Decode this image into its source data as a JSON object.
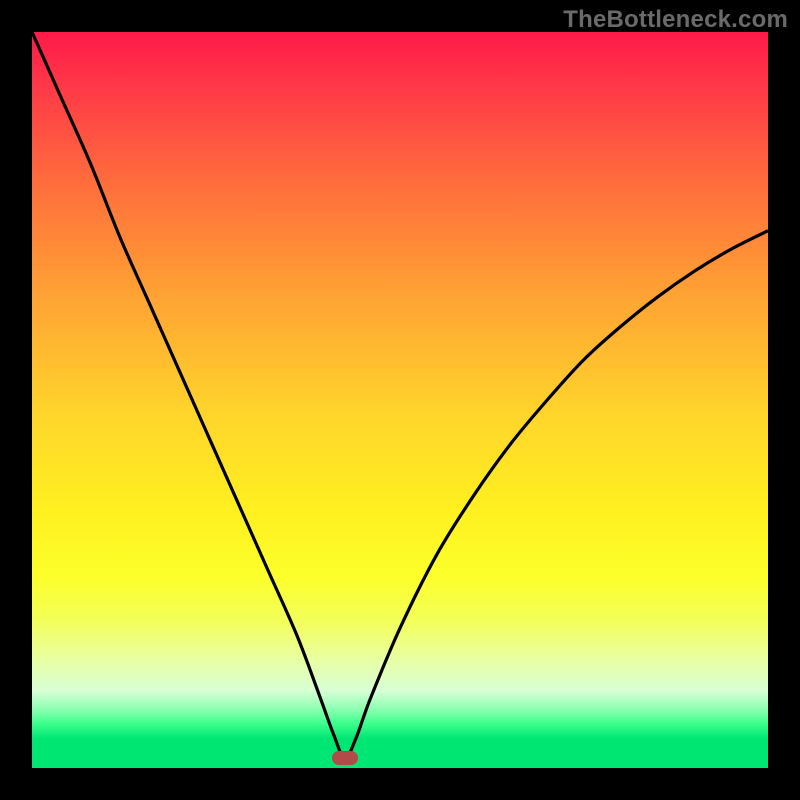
{
  "watermark": "TheBottleneck.com",
  "colors": {
    "frame": "#000000",
    "curve": "#000000",
    "marker": "#b24a4a",
    "gradient_top": "#ff1a49",
    "gradient_bottom": "#00e673"
  },
  "chart_data": {
    "type": "line",
    "title": "",
    "xlabel": "",
    "ylabel": "",
    "xlim": [
      0,
      100
    ],
    "ylim": [
      0,
      100
    ],
    "annotations": [
      "TheBottleneck.com"
    ],
    "marker": {
      "x": 42.5,
      "y": 1.4
    },
    "series": [
      {
        "name": "bottleneck-curve",
        "x": [
          0,
          4,
          8,
          12,
          16,
          20,
          24,
          28,
          32,
          36,
          39,
          41,
          42.5,
          44,
          46,
          50,
          55,
          60,
          65,
          70,
          75,
          80,
          85,
          90,
          95,
          100
        ],
        "values": [
          100,
          91,
          82,
          72,
          63,
          54,
          45,
          36,
          27,
          18,
          10,
          4.5,
          1.3,
          4.0,
          9.5,
          19,
          29,
          37,
          44,
          50,
          55.5,
          60,
          64,
          67.5,
          70.5,
          73
        ]
      }
    ]
  }
}
